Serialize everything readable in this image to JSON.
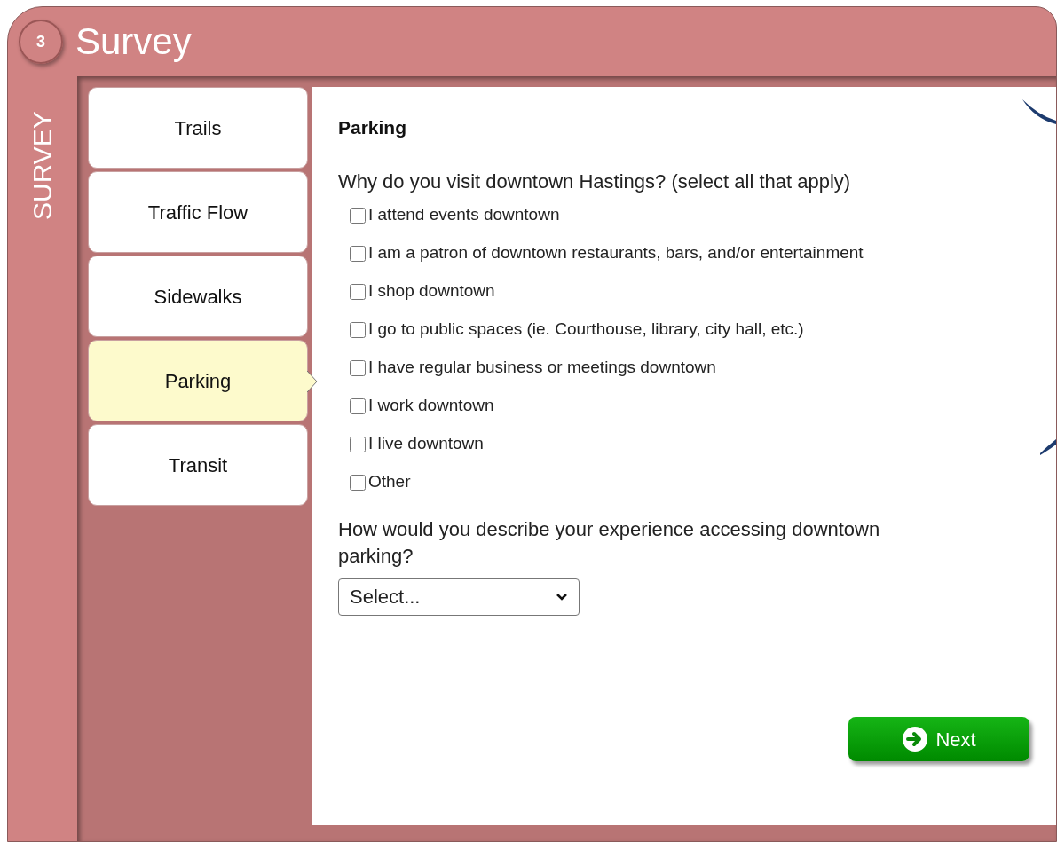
{
  "header": {
    "step": "3",
    "title": "Survey"
  },
  "side_label": "SURVEY",
  "tabs": [
    {
      "label": "Trails",
      "selected": false
    },
    {
      "label": "Traffic Flow",
      "selected": false
    },
    {
      "label": "Sidewalks",
      "selected": false
    },
    {
      "label": "Parking",
      "selected": true
    },
    {
      "label": "Transit",
      "selected": false
    }
  ],
  "content": {
    "heading": "Parking",
    "question_1": "Why do you visit downtown Hastings? (select all that apply)",
    "options": [
      {
        "label": "I attend events downtown",
        "checked": false
      },
      {
        "label": "I am a patron of downtown restaurants, bars, and/or entertainment",
        "checked": false
      },
      {
        "label": "I shop downtown",
        "checked": false
      },
      {
        "label": "I go to public spaces (ie. Courthouse, library, city hall, etc.)",
        "checked": false
      },
      {
        "label": "I have regular business or meetings downtown",
        "checked": false
      },
      {
        "label": "I work downtown",
        "checked": false
      },
      {
        "label": "I live downtown",
        "checked": false
      },
      {
        "label": "Other",
        "checked": false
      }
    ],
    "question_2": "How would you describe your experience accessing downtown parking?",
    "select": {
      "value": "Select..."
    },
    "next_button": "Next"
  }
}
